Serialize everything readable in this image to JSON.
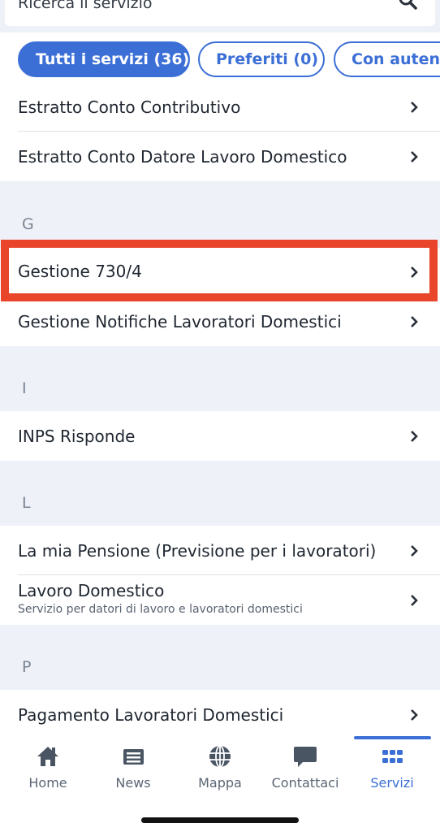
{
  "search": {
    "placeholder": "Ricerca il servizio"
  },
  "filters": [
    {
      "label": "Tutti i servizi (36)",
      "active": true
    },
    {
      "label": "Preferiti (0)",
      "active": false
    },
    {
      "label": "Con autenti",
      "active": false
    }
  ],
  "services_top": [
    {
      "label": "Estratto Conto Contributivo"
    },
    {
      "label": "Estratto Conto Datore Lavoro Domestico"
    }
  ],
  "sections": {
    "g": {
      "letter": "G",
      "items": [
        {
          "label": "Gestione 730/4"
        },
        {
          "label": "Gestione Notifiche Lavoratori Domestici"
        }
      ]
    },
    "i": {
      "letter": "I",
      "items": [
        {
          "label": "INPS Risponde"
        }
      ]
    },
    "l": {
      "letter": "L",
      "items": [
        {
          "label": "La mia Pensione (Previsione per i lavoratori)"
        },
        {
          "label": "Lavoro Domestico",
          "subtitle": "Servizio per datori di lavoro e lavoratori domestici"
        }
      ]
    },
    "p": {
      "letter": "P",
      "items": [
        {
          "label": "Pagamento Lavoratori Domestici"
        }
      ]
    }
  },
  "tabbar": {
    "home": "Home",
    "news": "News",
    "mappa": "Mappa",
    "contattaci": "Contattaci",
    "servizi": "Servizi",
    "active": "Servizi"
  },
  "colors": {
    "accent": "#3c6fd6",
    "highlight": "#e8452a",
    "section_bg": "#eef1f7"
  }
}
